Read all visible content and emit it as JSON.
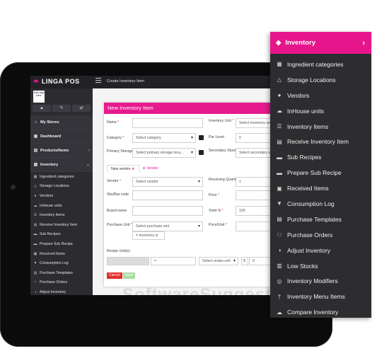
{
  "app": {
    "logo_text": "LINGA POS",
    "breadcrumb": "Create Inventory Item",
    "store_logo_text": "Your logo here"
  },
  "sidebar": {
    "top_buttons": [
      "▲",
      "✎",
      "⇄"
    ],
    "items": [
      {
        "label": "My Stores",
        "icon": "store-icon"
      },
      {
        "label": "Dashboard",
        "icon": "dashboard-icon"
      },
      {
        "label": "Products/Items",
        "icon": "products-icon",
        "has_chevron": true
      },
      {
        "label": "Inventory",
        "icon": "inventory-icon",
        "has_chevron": true
      }
    ],
    "sub_items": [
      "Ingredient categories",
      "Storage Locations",
      "Vendors",
      "InHouse units",
      "Inventory Items",
      "Receive Inventory Item",
      "Sub Recipes",
      "Prepare Sub Recipe",
      "Received Items",
      "Consumption Log",
      "Purchase Templates",
      "Purchase Orders",
      "Adjust Inventory"
    ]
  },
  "modal": {
    "title": "New Inventory Item",
    "fields": {
      "name_label": "Name",
      "name_value": "",
      "category_label": "Category",
      "category_value": "Select category",
      "primary_storage_label": "Primary Storage",
      "primary_storage_value": "Select primary storage loca...",
      "inventory_unit_label": "Inventory Unit",
      "inventory_unit_value": "Select inventory unit",
      "par_level_label": "Par Level",
      "par_level_value": "0",
      "secondary_storage_label": "Secondary Storage",
      "secondary_storage_value": "Select secondary storage",
      "vendor_label": "Vendor",
      "vendor_value": "Select vendor",
      "receiving_qty_label": "Receiving Quantity",
      "receiving_qty_value": "1",
      "sku_label": "Sku/Bar code",
      "sku_value": "",
      "price_label": "Price",
      "price_value": "",
      "brand_label": "Brand name",
      "brand_value": "",
      "yield_label": "Yield %",
      "yield_value": "100",
      "purchase_unit_label": "Purchase Unit",
      "purchase_unit_value": "Select purchase unit",
      "inventory_ur_value": "= Inventory ur",
      "price_unit_label": "Price/Unit",
      "price_unit_value": "",
      "recipe_units_label": "Recipe Unit(s)",
      "recipe_eq_value": "=",
      "recipe_unit_value": "Select recipe unit",
      "recipe_currency": "$",
      "recipe_amount": "0"
    },
    "tabs": [
      "New vendor",
      "Vendor"
    ],
    "buttons": {
      "cancel": "Cancel",
      "save": "Save"
    }
  },
  "watermark": "SoftwareSuggest",
  "floating_menu": {
    "title": "Inventory",
    "items": [
      {
        "label": "Ingredient categories",
        "icon": "grid-icon"
      },
      {
        "label": "Storage Locations",
        "icon": "flask-icon"
      },
      {
        "label": "Vendors",
        "icon": "user-icon"
      },
      {
        "label": "InHouse units",
        "icon": "cloud-icon"
      },
      {
        "label": "Inventory Items",
        "icon": "list-icon"
      },
      {
        "label": "Receive Inventory Item",
        "icon": "receive-icon"
      },
      {
        "label": "Sub Recipes",
        "icon": "folder-icon"
      },
      {
        "label": "Prepare Sub Recipe",
        "icon": "prepare-icon"
      },
      {
        "label": "Received Items",
        "icon": "image-icon"
      },
      {
        "label": "Consumption Log",
        "icon": "funnel-icon"
      },
      {
        "label": "Purchase Templates",
        "icon": "document-icon"
      },
      {
        "label": "Purchase Orders",
        "icon": "file-icon"
      },
      {
        "label": "Adjust Inventory",
        "icon": "adjust-icon"
      },
      {
        "label": "Low Stocks",
        "icon": "database-icon"
      },
      {
        "label": "Inventory Modifiers",
        "icon": "modifiers-icon"
      },
      {
        "label": "Inventory Menu Items",
        "icon": "cutlery-icon"
      },
      {
        "label": "Compare Inventory",
        "icon": "compare-icon"
      }
    ]
  },
  "colors": {
    "accent": "#e6158c",
    "sidebar_bg": "#2c2c30",
    "topbar_bg": "#222226",
    "cancel": "#e0302b",
    "save": "#a9dca1"
  }
}
